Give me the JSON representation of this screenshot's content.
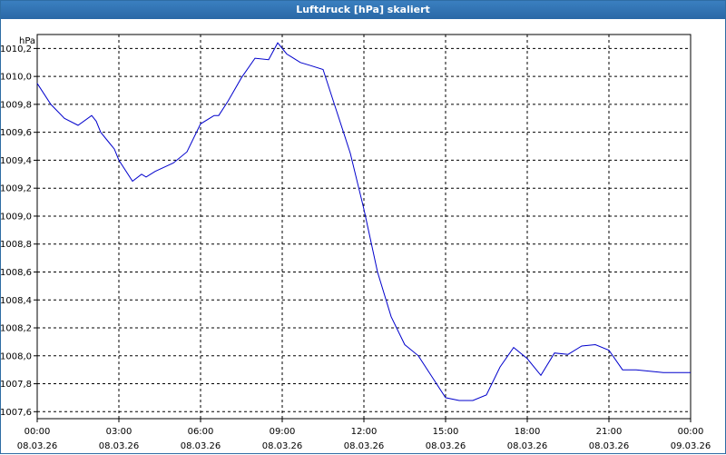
{
  "window": {
    "title": "Luftdruck [hPa] skaliert"
  },
  "chart_data": {
    "type": "line",
    "title": "Luftdruck [hPa] skaliert",
    "ylabel": "hPa",
    "xlabel": "",
    "ylim": [
      1007.55,
      1010.3
    ],
    "xlim": [
      "08.03.26 00:00",
      "09.03.26 00:00"
    ],
    "grid": true,
    "line_color": "#0000cc",
    "y_ticks": [
      "1007,6",
      "1007,8",
      "1008,0",
      "1008,2",
      "1008,4",
      "1008,6",
      "1008,8",
      "1009,0",
      "1009,2",
      "1009,4",
      "1009,6",
      "1009,8",
      "1010,0",
      "1010,2"
    ],
    "y_tick_values": [
      1007.6,
      1007.8,
      1008.0,
      1008.2,
      1008.4,
      1008.6,
      1008.8,
      1009.0,
      1009.2,
      1009.4,
      1009.6,
      1009.8,
      1010.0,
      1010.2
    ],
    "x_ticks": [
      {
        "time": "00:00",
        "date": "08.03.26"
      },
      {
        "time": "03:00",
        "date": "08.03.26"
      },
      {
        "time": "06:00",
        "date": "08.03.26"
      },
      {
        "time": "09:00",
        "date": "08.03.26"
      },
      {
        "time": "12:00",
        "date": "08.03.26"
      },
      {
        "time": "15:00",
        "date": "08.03.26"
      },
      {
        "time": "18:00",
        "date": "08.03.26"
      },
      {
        "time": "21:00",
        "date": "08.03.26"
      },
      {
        "time": "00:00",
        "date": "09.03.26"
      }
    ],
    "series": [
      {
        "x": [
          "00:00",
          "00:30",
          "01:00",
          "01:30",
          "02:00",
          "02:10",
          "02:20",
          "02:40",
          "02:50",
          "03:00",
          "03:30",
          "03:50",
          "04:00",
          "04:20",
          "04:40",
          "05:00",
          "05:30",
          "06:00",
          "06:30",
          "06:40",
          "07:00",
          "07:30",
          "08:00",
          "08:30",
          "08:50",
          "09:10",
          "09:20",
          "09:30",
          "09:40",
          "10:00",
          "10:30",
          "11:00",
          "11:30",
          "12:00",
          "12:30",
          "13:00",
          "13:30",
          "14:00",
          "14:30",
          "15:00",
          "15:30",
          "16:00",
          "16:30",
          "17:00",
          "17:30",
          "18:00",
          "18:30",
          "19:00",
          "19:30",
          "20:00",
          "20:30",
          "21:00",
          "21:30",
          "22:00",
          "22:30",
          "23:00",
          "23:30",
          "24:00"
        ],
        "values": [
          1009.95,
          1009.8,
          1009.7,
          1009.65,
          1009.72,
          1009.68,
          1009.6,
          1009.52,
          1009.48,
          1009.4,
          1009.25,
          1009.3,
          1009.28,
          1009.32,
          1009.35,
          1009.38,
          1009.46,
          1009.66,
          1009.72,
          1009.72,
          1009.82,
          1009.99,
          1010.13,
          1010.12,
          1010.24,
          1010.16,
          1010.14,
          1010.12,
          1010.1,
          1010.08,
          1010.05,
          1009.75,
          1009.45,
          1009.05,
          1008.6,
          1008.28,
          1008.08,
          1008.0,
          1007.85,
          1007.7,
          1007.68,
          1007.68,
          1007.72,
          1007.92,
          1008.06,
          1007.98,
          1007.86,
          1008.02,
          1008.01,
          1008.07,
          1008.08,
          1008.04,
          1007.9,
          1007.9,
          1007.89,
          1007.88,
          1007.88,
          1007.88
        ]
      }
    ]
  }
}
